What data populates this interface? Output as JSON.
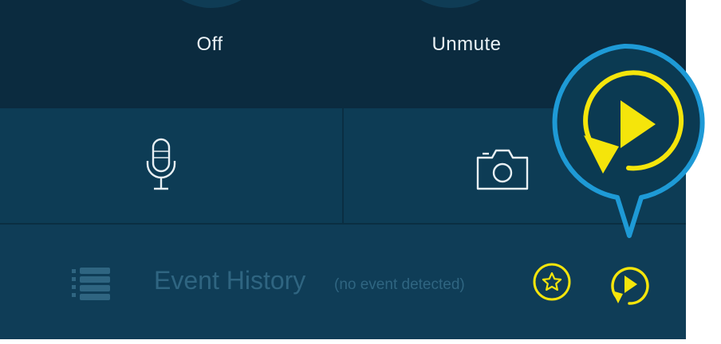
{
  "controls": {
    "off_label": "Off",
    "unmute_label": "Unmute"
  },
  "actions": {
    "microphone_icon": "microphone-icon",
    "camera_icon": "camera-icon"
  },
  "event_history": {
    "title": "Event History",
    "status": "(no event detected)",
    "list_icon": "list-icon",
    "favorite_icon": "star-icon",
    "replay_icon": "replay-icon"
  },
  "colors": {
    "background_dark": "#0b2b3f",
    "panel": "#0d3c55",
    "accent_yellow": "#f5e50b",
    "callout_blue": "#1e9ad6",
    "dim_text": "#2f6581"
  }
}
